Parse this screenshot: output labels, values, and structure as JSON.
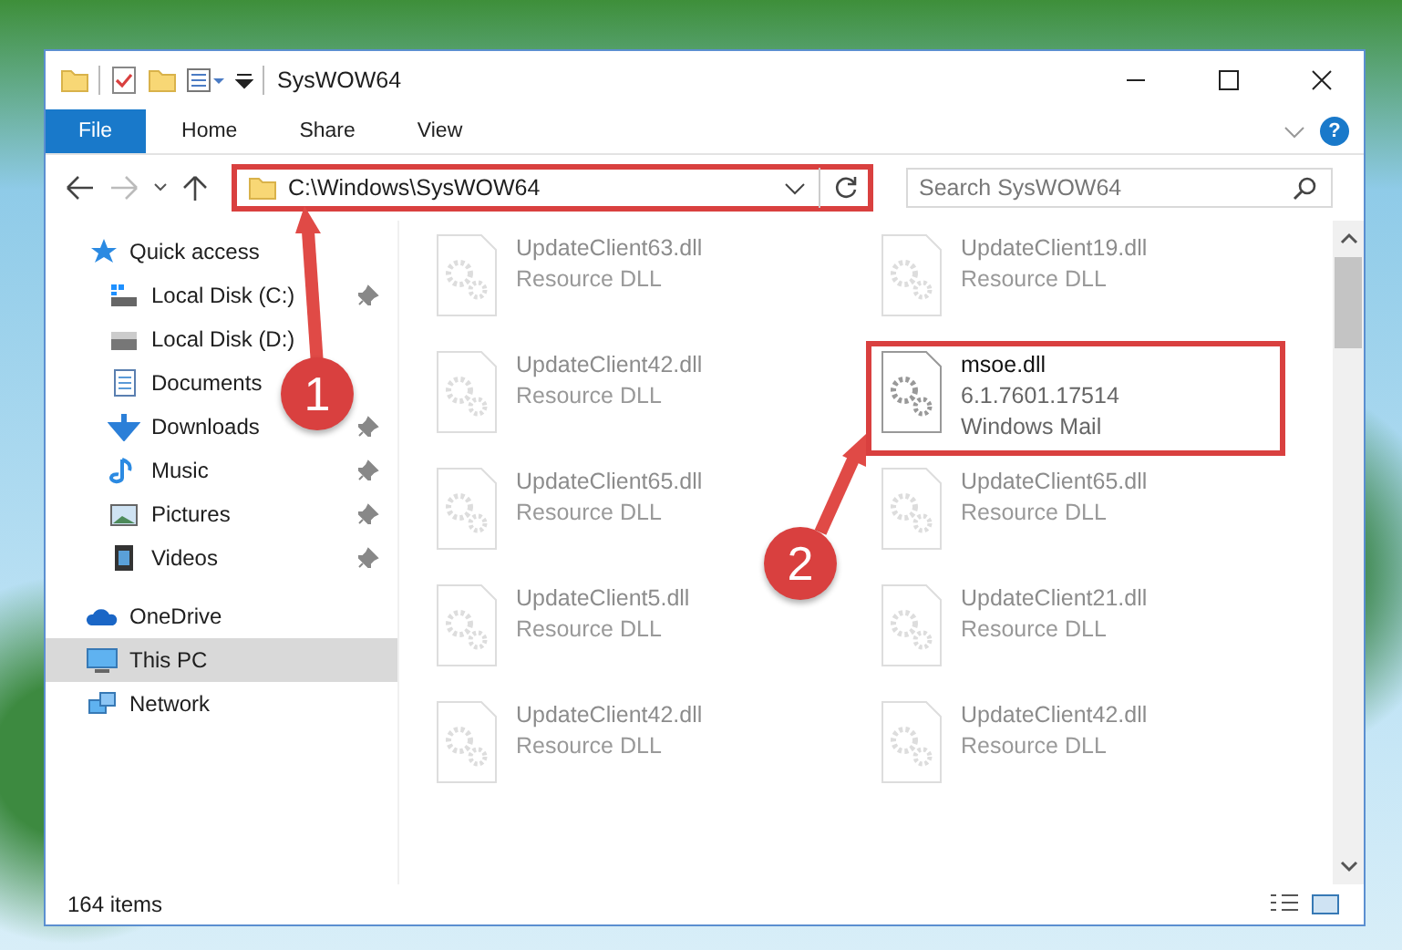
{
  "window": {
    "title": "SysWOW64"
  },
  "ribbon": {
    "tabs": [
      {
        "label": "File",
        "selected": true
      },
      {
        "label": "Home",
        "selected": false
      },
      {
        "label": "Share",
        "selected": false
      },
      {
        "label": "View",
        "selected": false
      }
    ],
    "help": "?"
  },
  "address": {
    "path": "C:\\Windows\\SysWOW64",
    "highlighted": true
  },
  "search": {
    "placeholder": "Search SysWOW64"
  },
  "sidebar": {
    "items": [
      {
        "label": "Quick access",
        "kind": "star",
        "selected": false,
        "children": [
          {
            "label": "Local Disk (C:)",
            "kind": "drive-windows",
            "pinned": true,
            "selected": false
          },
          {
            "label": "Local Disk (D:)",
            "kind": "drive",
            "pinned": false,
            "selected": false
          },
          {
            "label": "Documents",
            "kind": "document",
            "pinned": false,
            "selected": false
          },
          {
            "label": "Downloads",
            "kind": "download",
            "pinned": true,
            "selected": false
          },
          {
            "label": "Music",
            "kind": "music",
            "pinned": true,
            "selected": false
          },
          {
            "label": "Pictures",
            "kind": "picture",
            "pinned": true,
            "selected": false
          },
          {
            "label": "Videos",
            "kind": "video",
            "pinned": true,
            "selected": false
          }
        ]
      },
      {
        "label": "OneDrive",
        "kind": "cloud",
        "selected": false
      },
      {
        "label": "This PC",
        "kind": "computer",
        "selected": true
      },
      {
        "label": "Network",
        "kind": "network",
        "selected": false
      }
    ]
  },
  "files": [
    {
      "name": "UpdateClient63.dll",
      "details": [
        "Resource DLL"
      ],
      "highlighted": false
    },
    {
      "name": "UpdateClient19.dll",
      "details": [
        "Resource DLL"
      ],
      "highlighted": false
    },
    {
      "name": "UpdateClient42.dll",
      "details": [
        "Resource DLL"
      ],
      "highlighted": false
    },
    {
      "name": "msoe.dll",
      "details": [
        "6.1.7601.17514",
        "Windows Mail"
      ],
      "highlighted": true
    },
    {
      "name": "UpdateClient65.dll",
      "details": [
        "Resource DLL"
      ],
      "highlighted": false
    },
    {
      "name": "UpdateClient65.dll",
      "details": [
        "Resource DLL"
      ],
      "highlighted": false
    },
    {
      "name": "UpdateClient5.dll",
      "details": [
        "Resource DLL"
      ],
      "highlighted": false
    },
    {
      "name": "UpdateClient21.dll",
      "details": [
        "Resource DLL"
      ],
      "highlighted": false
    },
    {
      "name": "UpdateClient42.dll",
      "details": [
        "Resource DLL"
      ],
      "highlighted": false
    },
    {
      "name": "UpdateClient42.dll",
      "details": [
        "Resource DLL"
      ],
      "highlighted": false
    }
  ],
  "status_bar": {
    "item_count": "164 items"
  },
  "steps": [
    {
      "number": "1"
    },
    {
      "number": "2"
    }
  ]
}
